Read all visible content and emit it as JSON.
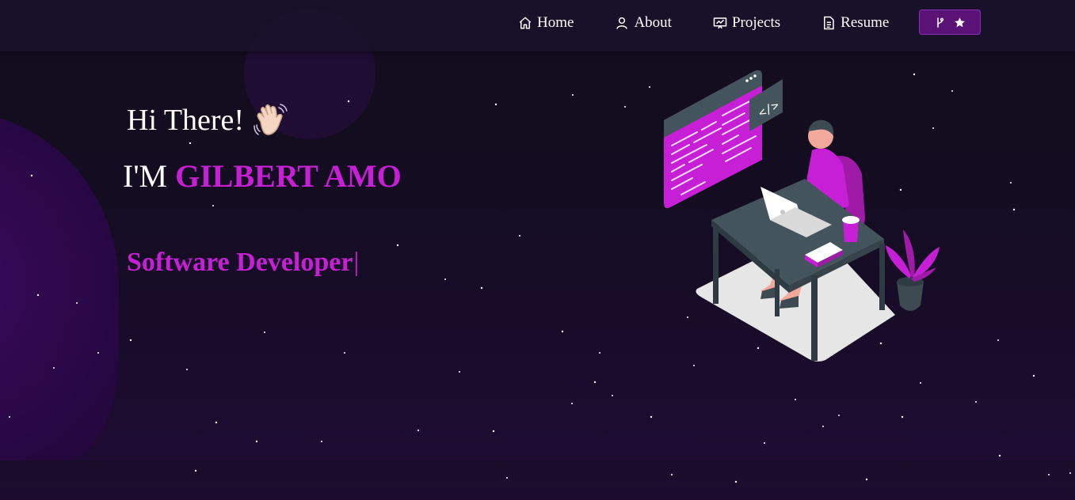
{
  "navbar": {
    "items": [
      {
        "label": "Home",
        "icon": "home-icon"
      },
      {
        "label": "About",
        "icon": "user-icon"
      },
      {
        "label": "Projects",
        "icon": "presentation-icon"
      },
      {
        "label": "Resume",
        "icon": "document-icon"
      }
    ],
    "github_button": {
      "icons": [
        "git-fork-icon",
        "star-icon"
      ]
    }
  },
  "hero": {
    "greeting": "Hi There!",
    "greeting_emoji": "waving-hand-icon",
    "intro_prefix": "I'M",
    "name": "GILBERT AMO",
    "role": "Software Developer",
    "cursor": "|"
  },
  "colors": {
    "accent": "#c71fd6",
    "background": "#150f22",
    "navbar": "#1a112b",
    "button": "#5a1277"
  }
}
